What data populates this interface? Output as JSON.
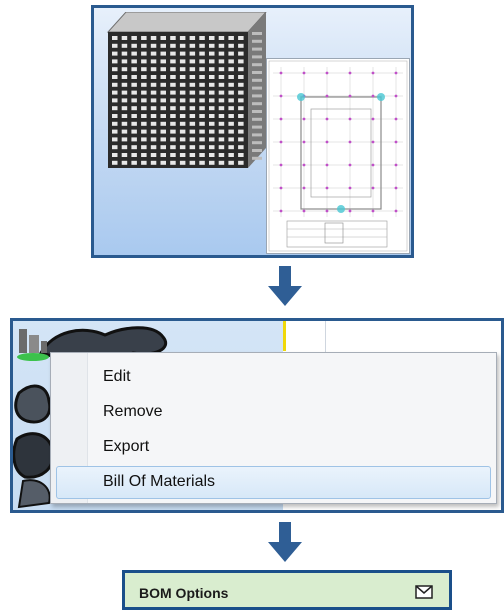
{
  "context_menu": {
    "items": [
      "Edit",
      "Remove",
      "Export",
      "Bill Of Materials"
    ],
    "highlighted_item": "Bill Of Materials"
  },
  "bom_dialog": {
    "title": "BOM Options",
    "icon": "envelope-icon"
  },
  "colors": {
    "panel_border": "#2a5a8f",
    "arrow": "#2f5e95",
    "highlight_bg": "#dbeaf8",
    "bom_header_bg": "#d9edcf"
  }
}
